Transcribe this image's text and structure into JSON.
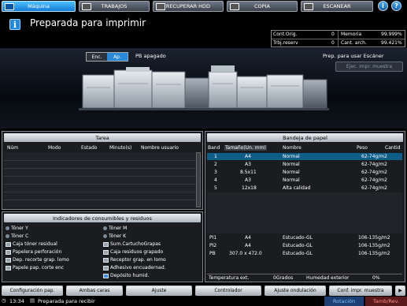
{
  "tabs": [
    {
      "label": "Máquina",
      "active": true,
      "icon": "printer-icon"
    },
    {
      "label": "TRABAJOS",
      "active": false,
      "icon": "list-icon"
    },
    {
      "label": "RECUPERAR HDD",
      "active": false,
      "icon": "hdd-icon"
    },
    {
      "label": "COPIA",
      "active": false,
      "icon": "copy-icon"
    },
    {
      "label": "ESCANEAR",
      "active": false,
      "icon": "scan-icon"
    }
  ],
  "top_buttons": {
    "info": "i",
    "help": "?"
  },
  "header": {
    "status": "Preparada para imprimir",
    "counters": [
      {
        "label": "Cont.Orig.",
        "value": "0",
        "label2": "Memoria",
        "value2": "99.999%"
      },
      {
        "label": "Trbj.reserv",
        "value": "0",
        "label2": "Cant. arch.",
        "value2": "99.421%"
      }
    ]
  },
  "machine": {
    "enc": "Enc.",
    "ap": "Ap.",
    "pb_status": "PB apagado",
    "scanner_status": "Prep. para usar Escáner",
    "ejec_button": "Ejec. impr. muestra"
  },
  "tarea": {
    "title": "Tarea",
    "columns": [
      "Núm",
      "Modo",
      "Estado",
      "Minuto(s)",
      "Nombre usuario"
    ]
  },
  "consumibles": {
    "title": "Indicadores de consumibles y residuos",
    "left": [
      "Tóner Y",
      "Tóner C",
      "Caja tóner residual",
      "Papelera perforación",
      "Dep. recorte grap. lomo",
      "Papele pap. corte enc"
    ],
    "right": [
      "Tóner M",
      "Tóner K",
      "Sum.CartuchoGrapas",
      "Caja residuos grapado",
      "Receptor grap. en lomo",
      "Adhesivo encuadernad.",
      "Depósito humid."
    ]
  },
  "bandeja": {
    "title": "Bandeja de papel",
    "columns": [
      "Band",
      "Tamaño(Un. mm)",
      "Nombre",
      "Peso",
      "Cantid"
    ],
    "rows": [
      {
        "band": "1",
        "size": "A4",
        "name": "Normal",
        "weight": "62-74g/m2",
        "selected": true
      },
      {
        "band": "2",
        "size": "A3",
        "name": "Normal",
        "weight": "62-74g/m2",
        "selected": false
      },
      {
        "band": "3",
        "size": "8.5x11",
        "name": "Normal",
        "weight": "62-74g/m2",
        "selected": false
      },
      {
        "band": "4",
        "size": "A3",
        "name": "Normal",
        "weight": "62-74g/m2",
        "selected": false
      },
      {
        "band": "5",
        "size": "12x18",
        "name": "Alta calidad",
        "weight": "62-74g/m2",
        "selected": false
      }
    ],
    "lower_rows": [
      {
        "band": "PI1",
        "size": "A4",
        "name": "Estucado-GL",
        "weight": "106-135g/m2"
      },
      {
        "band": "PI2",
        "size": "A4",
        "name": "Estucado-GL",
        "weight": "106-135g/m2"
      },
      {
        "band": "PB",
        "size": "307.0 x 472.0",
        "name": "Estucado-GL",
        "weight": "106-135g/m2"
      }
    ],
    "temp_label": "Temperatura ext.",
    "temp_value": "0Grados",
    "hum_label": "Humedad exterior",
    "hum_value": "0%"
  },
  "bottom_buttons": [
    "Configuración pap.",
    "Ambas caras",
    "Ajuste",
    "Controlador",
    "Ajuste ondulación",
    "Conf. impr. muestra"
  ],
  "statusbar": {
    "time": "13:34",
    "message": "Preparada para recibir",
    "rotacion": "Rotación",
    "tamb_rev": "Tamb/Rev."
  }
}
